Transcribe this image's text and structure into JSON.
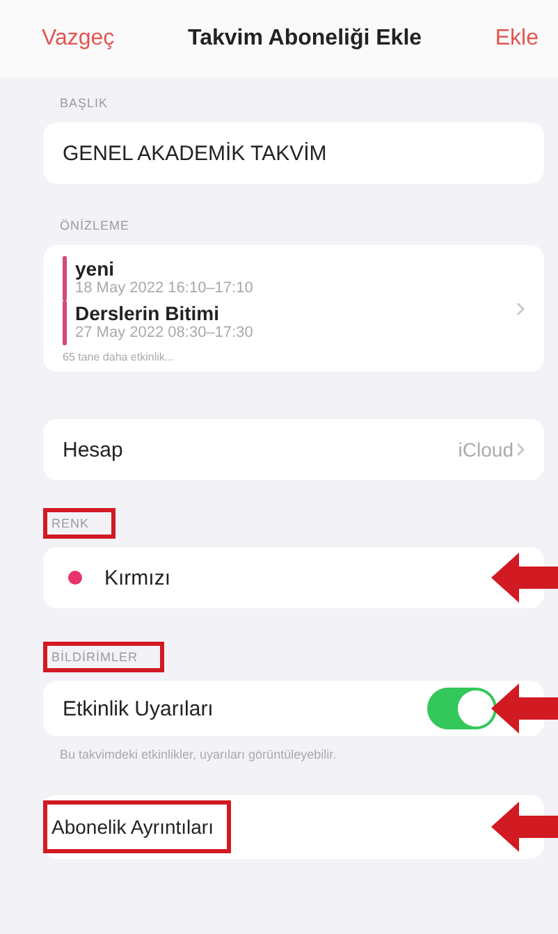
{
  "nav": {
    "cancel": "Vazgeç",
    "title": "Takvim Aboneliği Ekle",
    "add": "Ekle"
  },
  "title_section": {
    "header": "BAŞLIK",
    "value": "GENEL AKADEMİK TAKVİM"
  },
  "preview": {
    "header": "ÖNİZLEME",
    "events": [
      {
        "name": "yeni",
        "time": "18 May 2022 16:10–17:10"
      },
      {
        "name": "Derslerin Bitimi",
        "time": "27 May 2022 08:30–17:30"
      }
    ],
    "more": "65 tane daha etkinlik..."
  },
  "account": {
    "label": "Hesap",
    "value": "iCloud"
  },
  "color_section": {
    "header": "RENK",
    "header_highlighted": true,
    "label": "Kırmızı",
    "color": "#e8336b",
    "arrow": true
  },
  "alerts": {
    "header": "BİLDİRİMLER",
    "header_highlighted": true,
    "label": "Etkinlik Uyarıları",
    "on": true,
    "arrow": true,
    "footer": "Bu takvimdeki etkinlikler, uyarıları görüntüleyebilir."
  },
  "details": {
    "label": "Abonelik Ayrıntıları",
    "highlighted": true,
    "arrow": true
  }
}
